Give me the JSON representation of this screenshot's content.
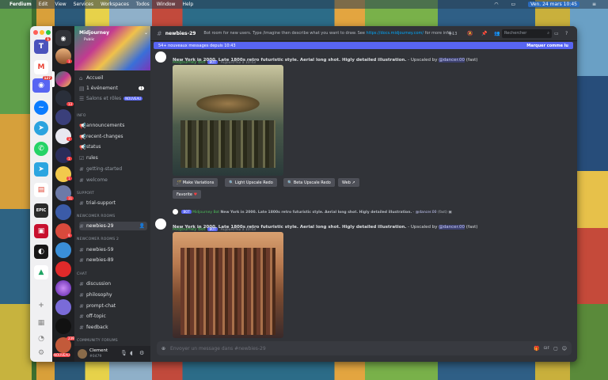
{
  "menubar": {
    "app": "Ferdium",
    "items": [
      "Edit",
      "View",
      "Services",
      "Workspaces",
      "Todos",
      "Window",
      "Help"
    ],
    "datetime": "Ven. 24 mars 10:45"
  },
  "server": {
    "name": "Midjourney",
    "public_label": "Public"
  },
  "channels": {
    "home": "Accueil",
    "events": "1 événement",
    "events_count": "1",
    "salons": "Salons et rôles",
    "nouveau": "NOUVEAU",
    "cat_info": "INFO",
    "announcements": "announcements",
    "recent_changes": "recent-changes",
    "status": "status",
    "rules": "rules",
    "getting_started": "getting-started",
    "welcome": "welcome",
    "cat_support": "SUPPORT",
    "trial_support": "trial-support",
    "cat_newcomer": "NEWCOMER ROOMS",
    "newbies29": "newbies-29",
    "cat_newcomer2": "NEWCOMER ROOMS 2",
    "newbies59": "newbies-59",
    "newbies89": "newbies-89",
    "cat_chat": "CHAT",
    "discussion": "discussion",
    "philosophy": "philosophy",
    "prompt_chat": "prompt-chat",
    "off_topic": "off-topic",
    "feedback": "feedback",
    "cat_forums": "COMMUNITY FORUMS"
  },
  "user": {
    "name": "Clement",
    "tag": "#0479"
  },
  "guild_footer": "NOUVEAU",
  "topbar": {
    "channel": "newbies-29",
    "topic": "Bot room for new users. Type /imagine then describe what you want to draw. See",
    "link": "https://docs.midjourney.com/",
    "more": "for more info...",
    "thread_count": "13",
    "search_placeholder": "Rechercher"
  },
  "newbar": {
    "text": "54+ nouveaux messages depuis 10:43",
    "action": "Marquer comme lu"
  },
  "msg1": {
    "author": "Midjourney Bot",
    "tag": "BOT",
    "time": "Aujourd'hui à 10:43",
    "text": "New York in 2000. Late 1800s retro futuristic style. Aerial long shot. Higly detailed illustration.",
    "suffix": " - Upscaled by ",
    "mention": "@dancer.00",
    "speed": " (fast)"
  },
  "buttons": {
    "make_variations": "Make Variations",
    "light_upscale": "Light Upscale Redo",
    "beta_upscale": "Beta Upscale Redo",
    "web": "Web",
    "favorite": "Favorite"
  },
  "reply": {
    "author": "Midjourney Bot",
    "tag": "BOT",
    "text": "New York in 2000. Late 1800s retro futuristic style. Aerial long shot. Higly detailed illustration.",
    "mention": "@dancer.00",
    "speed": "(fast)"
  },
  "msg2": {
    "author": "Midjourney Bot",
    "tag": "BOT",
    "time": "Aujourd'hui à 10:43",
    "text": "New York in 2000. Late 1800s retro futuristic style. Aerial long shot. Higly detailed illustration.",
    "suffix": " - Upscaled by ",
    "mention": "@dancer.00",
    "speed": " (fast)"
  },
  "composer": {
    "placeholder": "Envoyer un message dans #newbies-29"
  },
  "badges": {
    "ferdium_teams": "1",
    "ferdium_gmail": "",
    "ferdium_discord": "127",
    "guild_1": "1",
    "guild_2": "13",
    "guild_3": "1",
    "guild_4": "1",
    "guild_5": "11",
    "guild_6": "1",
    "guild_7": "9",
    "guild_8": "1",
    "guild_9": "9",
    "guild_10": "239",
    "guild_11": "3"
  },
  "colors": {
    "blurple": "#5865f2",
    "green_bot": "#4cc05a",
    "bg": "#313338"
  }
}
